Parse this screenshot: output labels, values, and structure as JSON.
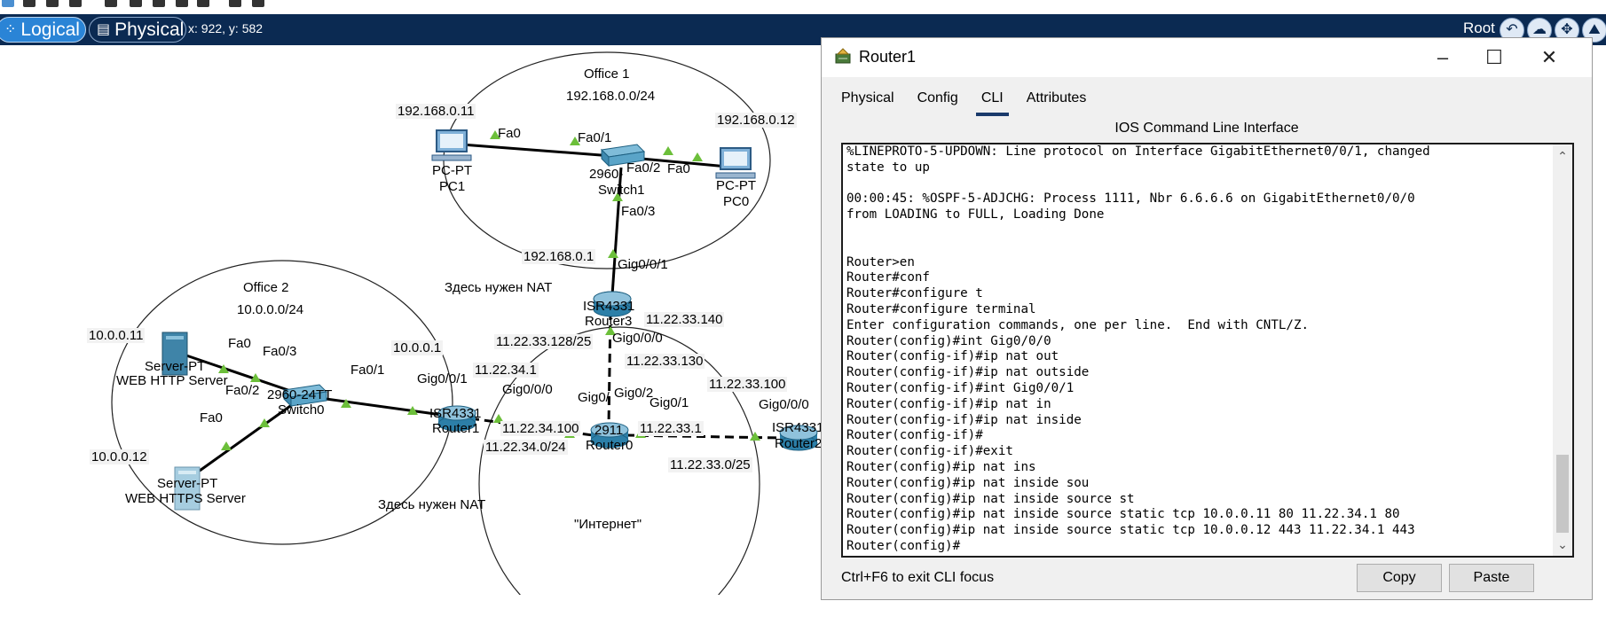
{
  "mode_bar": {
    "logical_label": "Logical",
    "physical_label": "Physical",
    "coordinates": "x: 922, y: 582",
    "root_label": "Root"
  },
  "topology": {
    "office1": {
      "name": "Office 1",
      "subnet": "192.168.0.0/24"
    },
    "office2": {
      "name": "Office 2",
      "subnet": "10.0.0.0/24"
    },
    "internet_label": "\"Интернет\"",
    "nat_note_1": "Здесь нужен NAT",
    "nat_note_2": "Здесь нужен NAT",
    "devices": {
      "pc1": {
        "type": "PC-PT",
        "name": "PC1",
        "ip": "192.168.0.11",
        "port": "Fa0"
      },
      "pc0": {
        "type": "PC-PT",
        "name": "PC0",
        "ip": "192.168.0.12",
        "port": "Fa0"
      },
      "switch1": {
        "type": "2960-",
        "name": "Switch1",
        "ports": [
          "Fa0/1",
          "Fa0/2",
          "Fa0/3"
        ]
      },
      "router3": {
        "type": "ISR4331",
        "name": "Router3",
        "gw": "192.168.0.1",
        "ports": [
          "Gig0/0/1",
          "Gig0/0/0"
        ],
        "wan_ip": "11.22.33.140",
        "wan_net": "11.22.33.128/25"
      },
      "router0": {
        "type": "2911",
        "name": "Router0",
        "ports": [
          "Gig0/",
          "Gig0/2",
          "Gig0/1"
        ],
        "ips": [
          "11.22.33.130",
          "11.22.34.100",
          "11.22.33.1"
        ]
      },
      "router1": {
        "type": "ISR4331",
        "name": "Router1",
        "gw": "10.0.0.1",
        "ports": [
          "Gig0/0/1",
          "Gig0/0/0"
        ],
        "wan_ip": "11.22.34.1",
        "wan_net": "11.22.34.0/24"
      },
      "router2": {
        "type": "ISR4331",
        "name": "Router2",
        "ip": "11.22.33.100",
        "port": "Gig0/0/0",
        "net": "11.22.33.0/25"
      },
      "switch0": {
        "type": "2960-24TT",
        "name": "Switch0",
        "ports": [
          "Fa0/1",
          "Fa0/2",
          "Fa0/3"
        ]
      },
      "server_http": {
        "type": "Server-PT",
        "name": "WEB HTTP Server",
        "ip": "10.0.0.11",
        "port": "Fa0"
      },
      "server_https": {
        "type": "Server-PT",
        "name": "WEB HTTPS Server",
        "ip": "10.0.0.12",
        "port": "Fa0"
      }
    }
  },
  "window": {
    "title": "Router1",
    "tabs": [
      "Physical",
      "Config",
      "CLI",
      "Attributes"
    ],
    "active_tab": "CLI",
    "heading": "IOS Command Line Interface",
    "cli_lines": [
      "%LINEPROTO-5-UPDOWN: Line protocol on Interface GigabitEthernet0/0/1, changed",
      "state to up",
      "",
      "00:00:45: %OSPF-5-ADJCHG: Process 1111, Nbr 6.6.6.6 on GigabitEthernet0/0/0",
      "from LOADING to FULL, Loading Done",
      "",
      "",
      "Router>en",
      "Router#conf",
      "Router#configure t",
      "Router#configure terminal",
      "Enter configuration commands, one per line.  End with CNTL/Z.",
      "Router(config)#int Gig0/0/0",
      "Router(config-if)#ip nat out",
      "Router(config-if)#ip nat outside",
      "Router(config-if)#int Gig0/0/1",
      "Router(config-if)#ip nat in",
      "Router(config-if)#ip nat inside",
      "Router(config-if)#",
      "Router(config-if)#exit",
      "Router(config)#ip nat ins",
      "Router(config)#ip nat inside sou",
      "Router(config)#ip nat inside source st",
      "Router(config)#ip nat inside source static tcp 10.0.0.11 80 11.22.34.1 80",
      "Router(config)#ip nat inside source static tcp 10.0.0.12 443 11.22.34.1 443",
      "Router(config)#"
    ],
    "footer_hint": "Ctrl+F6 to exit CLI focus",
    "copy_label": "Copy",
    "paste_label": "Paste"
  },
  "colors": {
    "mode_bar_bg": "#0b2a52",
    "active_mode": "#2a84d6",
    "link_up": "#6cbf3a",
    "router_blue": "#2c7fa8"
  }
}
